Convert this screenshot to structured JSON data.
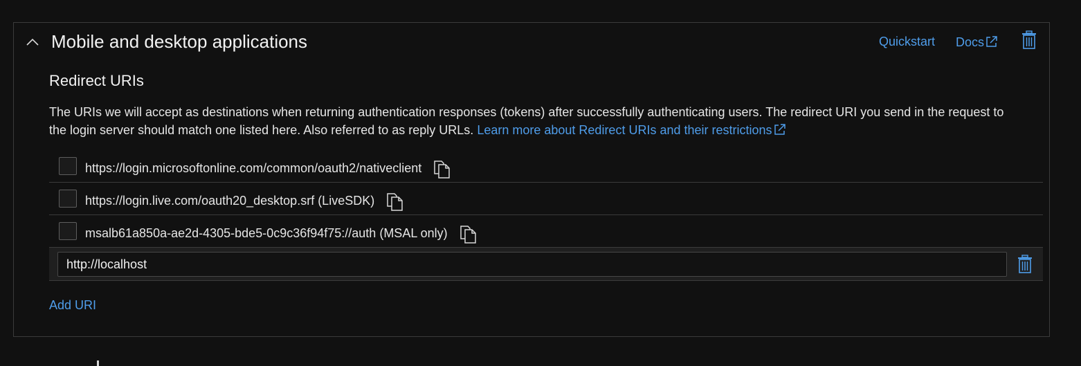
{
  "section": {
    "title": "Mobile and desktop applications",
    "quickstart_label": "Quickstart",
    "docs_label": "Docs"
  },
  "redirect": {
    "title": "Redirect URIs",
    "description": "The URIs we will accept as destinations when returning authentication responses (tokens) after successfully authenticating users. The redirect URI you send in the request to the login server should match one listed here. Also referred to as reply URLs.",
    "learn_more_label": "Learn more about Redirect URIs and their restrictions",
    "uris": [
      {
        "label": "https://login.microsoftonline.com/common/oauth2/nativeclient",
        "checked": false
      },
      {
        "label": "https://login.live.com/oauth20_desktop.srf (LiveSDK)",
        "checked": false
      },
      {
        "label": "msalb61a850a-ae2d-4305-bde5-0c9c36f94f75://auth (MSAL only)",
        "checked": false
      }
    ],
    "new_uri_value": "http://localhost",
    "add_uri_label": "Add URI"
  },
  "colors": {
    "background": "#111111",
    "border": "#3b3b3b",
    "link": "#4f9dea",
    "text": "#e6e6e6"
  },
  "icons": [
    "chevron-up-icon",
    "external-link-icon",
    "trash-icon",
    "copy-icon"
  ]
}
